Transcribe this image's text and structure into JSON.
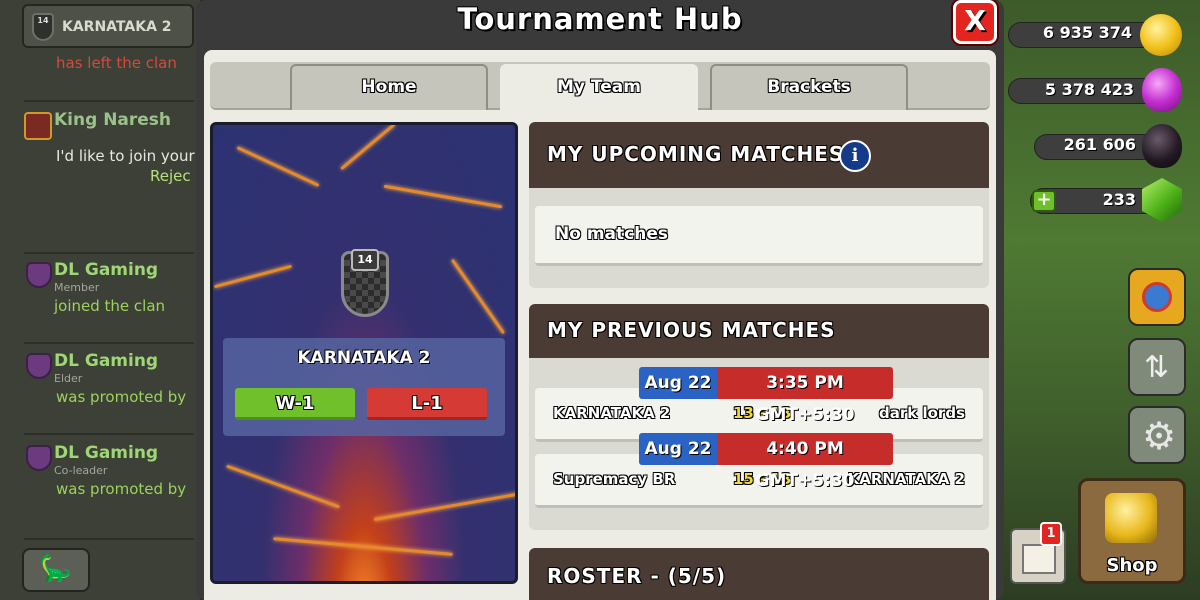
{
  "chat": {
    "clan_name": "KARNATAKA 2",
    "clan_level": "14",
    "messages": [
      {
        "text": "has left the clan"
      },
      {
        "name": "King Naresh",
        "text": "I'd like to join your",
        "sub": "Rejec"
      },
      {
        "name": "DL Gaming",
        "role": "Member",
        "text": "joined the clan"
      },
      {
        "name": "DL Gaming",
        "role": "Elder",
        "text": "was promoted by"
      },
      {
        "name": "DL Gaming",
        "role": "Co-leader",
        "text": "was promoted by"
      }
    ]
  },
  "resources": {
    "gold": "6 935 374",
    "elixir": "5 378 423",
    "dark_elixir": "261 606",
    "gems": "233",
    "shop_label": "Shop",
    "notification_count": "1"
  },
  "modal": {
    "title": "Tournament Hub",
    "close_label": "X",
    "tabs": [
      {
        "label": "Home",
        "active": false
      },
      {
        "label": "My Team",
        "active": true
      },
      {
        "label": "Brackets",
        "active": false
      }
    ],
    "team": {
      "name": "KARNATAKA 2",
      "badge_level": "14",
      "wins": "W-1",
      "losses": "L-1"
    },
    "upcoming": {
      "title": "MY UPCOMING MATCHES",
      "info_icon": "i",
      "empty_text": "No matches"
    },
    "previous": {
      "title": "MY PREVIOUS MATCHES",
      "matches": [
        {
          "date": "Aug 22",
          "time": "3:35 PM GMT+5:30",
          "team_left": "KARNATAKA 2",
          "score": "13 - 13",
          "team_right": "dark lords"
        },
        {
          "date": "Aug 22",
          "time": "4:40 PM GMT+5:30",
          "team_left": "Supremacy BR",
          "score": "15 - 13",
          "team_right": "KARNATAKA 2"
        }
      ]
    },
    "roster": {
      "title": "ROSTER - (5/5)"
    }
  }
}
